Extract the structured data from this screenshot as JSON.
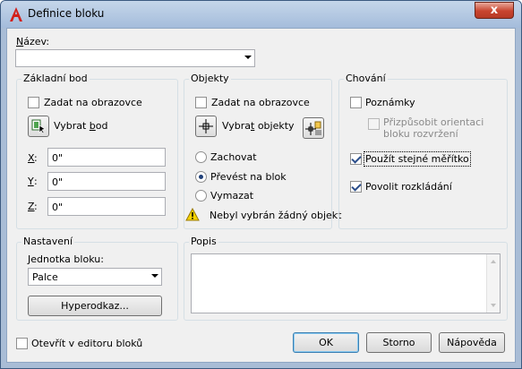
{
  "window": {
    "title": "Definice bloku",
    "close_glyph": "x",
    "app_icon": "autocad-a-icon"
  },
  "name_field": {
    "label_underlined": "N",
    "label_rest": "ázev:",
    "value": ""
  },
  "base_point": {
    "title": "Základní bod",
    "specify_on_screen": "Zadat na obrazovce",
    "pick_point_pre": "Vybrat ",
    "pick_point_ul": "b",
    "pick_point_post": "od",
    "x_label": "X",
    "x_value": "0\"",
    "y_label": "Y",
    "y_value": "0\"",
    "z_label": "Z",
    "z_value": "0\""
  },
  "objects": {
    "title": "Objekty",
    "specify_on_screen": "Zadat na obrazovce",
    "select_objects_pre": "Vybra",
    "select_objects_ul": "t",
    "select_objects_post": " objekty",
    "retain": "Zachovat",
    "convert": "Převést na blok",
    "delete": "Vymazat",
    "warning": "Nebyl vybrán žádný objekt"
  },
  "behavior": {
    "title": "Chování",
    "annotative": "Poznámky",
    "match_orientation": "Přizpůsobit orientaci bloku rozvržení",
    "scale_uniformly": "Použít stejné měřítko",
    "allow_exploding": "Povolit rozkládání"
  },
  "settings": {
    "title": "Nastavení",
    "unit_label": "Jednotka bloku:",
    "unit_value": "Palce",
    "hyperlink_button": "Hyperodkaz..."
  },
  "description": {
    "title": "Popis",
    "value": ""
  },
  "footer": {
    "open_in_editor": "Otevřít v editoru bloků",
    "ok": "OK",
    "cancel": "Storno",
    "help": "Nápověda"
  },
  "state": {
    "specify_base_on_screen": false,
    "specify_objects_on_screen": false,
    "selected_object_action": "convert",
    "annotative": false,
    "match_orientation": false,
    "scale_uniformly": true,
    "allow_exploding": true,
    "open_in_editor": false
  },
  "colors": {
    "title_bar": "#a4bcdb",
    "close_button": "#c8442e",
    "dialog_face": "#f0f0f0",
    "warning_yellow": "#f5d200"
  }
}
